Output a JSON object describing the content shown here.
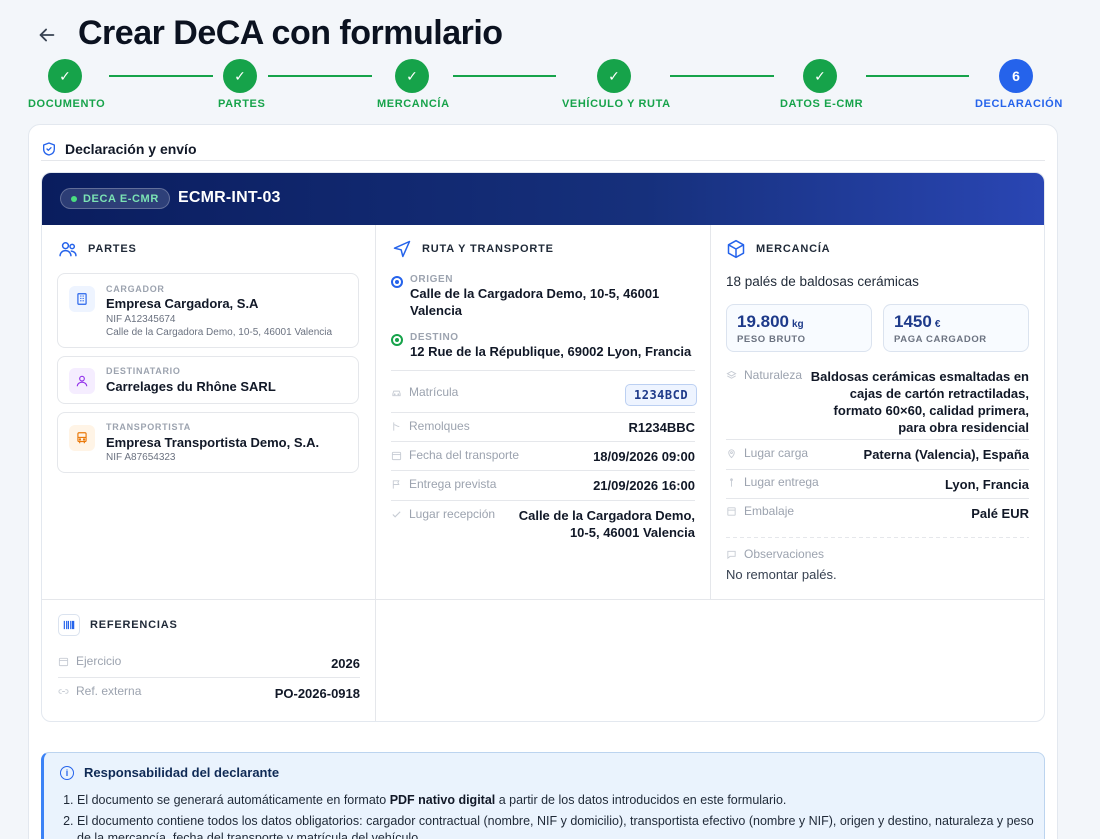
{
  "header": {
    "title": "Crear DeCA con formulario",
    "back_icon": "arrow-left-icon"
  },
  "stepper": {
    "steps": [
      {
        "label": "DOCUMENTO",
        "status": "done",
        "mark": "✓"
      },
      {
        "label": "PARTES",
        "status": "done",
        "mark": "✓"
      },
      {
        "label": "MERCANCÍA",
        "status": "done",
        "mark": "✓"
      },
      {
        "label": "VEHÍCULO Y RUTA",
        "status": "done",
        "mark": "✓"
      },
      {
        "label": "DATOS E-CMR",
        "status": "done",
        "mark": "✓"
      },
      {
        "label": "DECLARACIÓN",
        "status": "current",
        "mark": "6"
      }
    ],
    "colors": {
      "done": "#16a34a",
      "current": "#2563eb"
    }
  },
  "card": {
    "title": "Declaración y envío",
    "badge": "DECA E-CMR",
    "doc_id": "ECMR-INT-03"
  },
  "partes": {
    "title": "PARTES",
    "cargador": {
      "role": "CARGADOR",
      "name": "Empresa Cargadora, S.A",
      "nif": "NIF A12345674",
      "address": "Calle de la Cargadora Demo, 10-5, 46001 Valencia"
    },
    "destinatario": {
      "role": "DESTINATARIO",
      "name": "Carrelages du Rhône SARL"
    },
    "transportista": {
      "role": "TRANSPORTISTA",
      "name": "Empresa Transportista Demo, S.A.",
      "nif": "NIF A87654323"
    }
  },
  "ruta": {
    "title": "RUTA Y TRANSPORTE",
    "origen_label": "ORIGEN",
    "origen": "Calle de la Cargadora Demo, 10-5, 46001 Valencia",
    "destino_label": "DESTINO",
    "destino": "12 Rue de la République, 69002 Lyon, Francia",
    "matricula_label": "Matrícula",
    "matricula": "1234BCD",
    "remolques_label": "Remolques",
    "remolques": "R1234BBC",
    "fecha_label": "Fecha del transporte",
    "fecha": "18/09/2026 09:00",
    "entrega_label": "Entrega prevista",
    "entrega": "21/09/2026 16:00",
    "recepcion_label": "Lugar recepción",
    "recepcion": "Calle de la Cargadora Demo, 10-5, 46001 Valencia"
  },
  "mercancia": {
    "title": "MERCANCÍA",
    "descripcion": "18 palés de baldosas cerámicas",
    "peso_value": "19.800",
    "peso_unit": "kg",
    "peso_label": "PESO BRUTO",
    "paga_value": "1450",
    "paga_unit": "€",
    "paga_label": "PAGA CARGADOR",
    "naturaleza_label": "Naturaleza",
    "naturaleza": "Baldosas cerámicas esmaltadas en cajas de cartón retractiladas, formato 60×60, calidad primera, para obra residencial",
    "carga_label": "Lugar carga",
    "carga": "Paterna (Valencia), España",
    "entrega_label": "Lugar entrega",
    "entrega": "Lyon, Francia",
    "embalaje_label": "Embalaje",
    "embalaje": "Palé EUR",
    "observaciones_label": "Observaciones",
    "observaciones": "No remontar palés."
  },
  "referencias": {
    "title": "REFERENCIAS",
    "ejercicio_label": "Ejercicio",
    "ejercicio": "2026",
    "ref_label": "Ref. externa",
    "ref": "PO-2026-0918"
  },
  "responsabilidad": {
    "title": "Responsabilidad del declarante",
    "item1_pre": "El documento se generará automáticamente en formato ",
    "item1_bold": "PDF nativo digital",
    "item1_post": " a partir de los datos introducidos en este formulario.",
    "item2": "El documento contiene todos los datos obligatorios: cargador contractual (nombre, NIF y domicilio), transportista efectivo (nombre y NIF), origen y destino, naturaleza y peso de la mercancía, fecha del transporte y matrícula del vehículo."
  }
}
